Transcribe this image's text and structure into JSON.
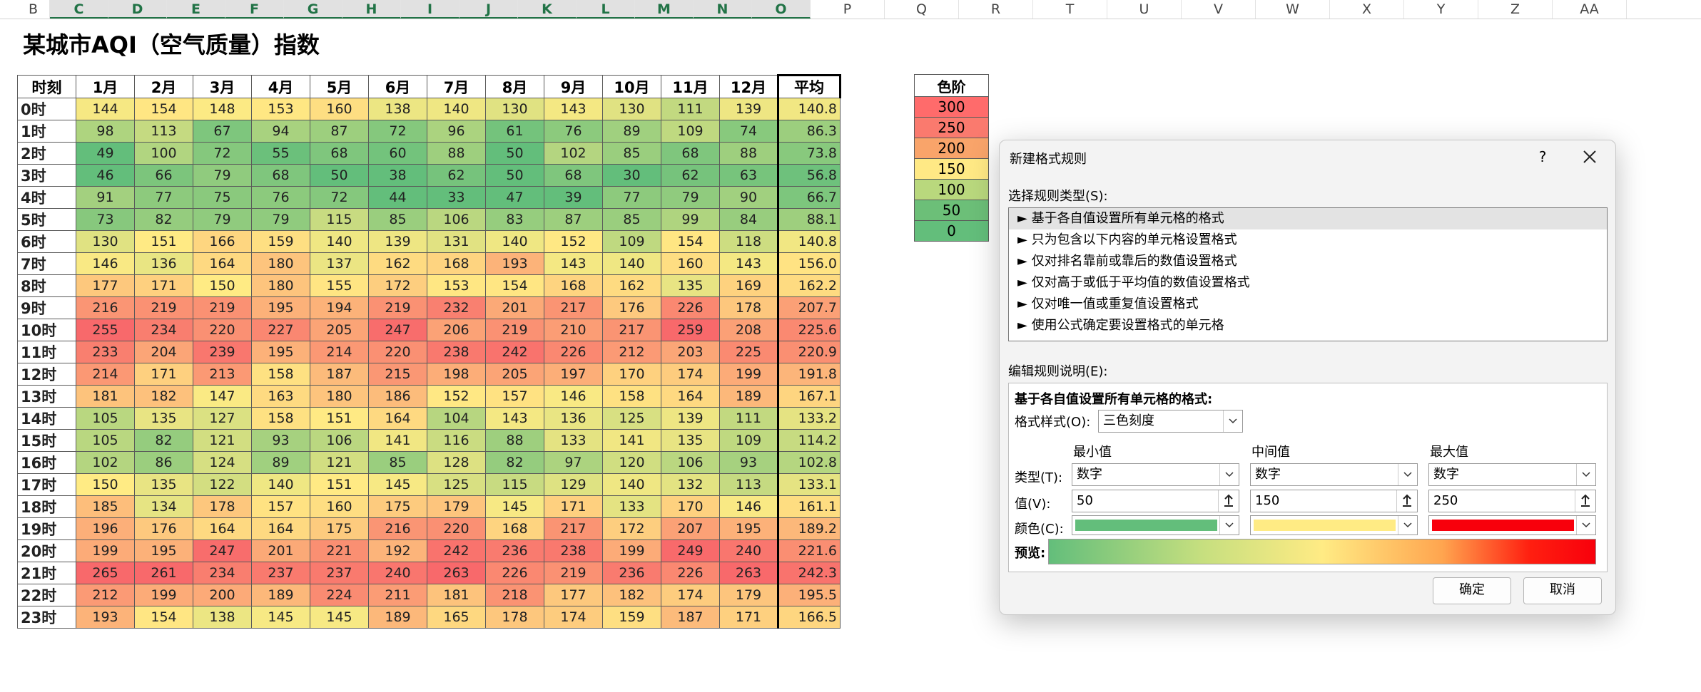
{
  "columns": [
    "B",
    "C",
    "D",
    "E",
    "F",
    "G",
    "H",
    "I",
    "J",
    "K",
    "L",
    "M",
    "N",
    "O",
    "P",
    "Q",
    "R",
    "T",
    "U",
    "V",
    "W",
    "X",
    "Y",
    "Z",
    "AA"
  ],
  "sheet_title": "某城市AQI（空气质量）指数",
  "table": {
    "corner": "时刻",
    "months": [
      "1月",
      "2月",
      "3月",
      "4月",
      "5月",
      "6月",
      "7月",
      "8月",
      "9月",
      "10月",
      "11月",
      "12月"
    ],
    "avg_header": "平均",
    "rows": [
      {
        "hour": "0时",
        "values": [
          144,
          154,
          148,
          153,
          160,
          138,
          140,
          130,
          143,
          130,
          111,
          139
        ],
        "avg": "140.8"
      },
      {
        "hour": "1时",
        "values": [
          98,
          113,
          67,
          94,
          87,
          72,
          96,
          61,
          76,
          89,
          109,
          74
        ],
        "avg": "86.3"
      },
      {
        "hour": "2时",
        "values": [
          49,
          100,
          72,
          55,
          68,
          60,
          88,
          50,
          102,
          85,
          68,
          88
        ],
        "avg": "73.8"
      },
      {
        "hour": "3时",
        "values": [
          46,
          66,
          79,
          68,
          50,
          38,
          62,
          50,
          68,
          30,
          62,
          63
        ],
        "avg": "56.8"
      },
      {
        "hour": "4时",
        "values": [
          91,
          77,
          75,
          76,
          72,
          44,
          33,
          47,
          39,
          77,
          79,
          90
        ],
        "avg": "66.7"
      },
      {
        "hour": "5时",
        "values": [
          73,
          82,
          79,
          79,
          115,
          85,
          106,
          83,
          87,
          85,
          99,
          84
        ],
        "avg": "88.1"
      },
      {
        "hour": "6时",
        "values": [
          130,
          151,
          166,
          159,
          140,
          139,
          131,
          140,
          152,
          109,
          154,
          118
        ],
        "avg": "140.8"
      },
      {
        "hour": "7时",
        "values": [
          146,
          136,
          164,
          180,
          137,
          162,
          168,
          193,
          143,
          140,
          160,
          143
        ],
        "avg": "156.0"
      },
      {
        "hour": "8时",
        "values": [
          177,
          171,
          150,
          180,
          155,
          172,
          153,
          154,
          168,
          162,
          135,
          169
        ],
        "avg": "162.2"
      },
      {
        "hour": "9时",
        "values": [
          216,
          219,
          219,
          195,
          194,
          219,
          232,
          201,
          217,
          176,
          226,
          178
        ],
        "avg": "207.7"
      },
      {
        "hour": "10时",
        "values": [
          255,
          234,
          220,
          227,
          205,
          247,
          206,
          219,
          210,
          217,
          259,
          208
        ],
        "avg": "225.6"
      },
      {
        "hour": "11时",
        "values": [
          233,
          204,
          239,
          195,
          214,
          220,
          238,
          242,
          226,
          212,
          203,
          225
        ],
        "avg": "220.9"
      },
      {
        "hour": "12时",
        "values": [
          214,
          171,
          213,
          158,
          187,
          215,
          198,
          205,
          197,
          170,
          174,
          199
        ],
        "avg": "191.8"
      },
      {
        "hour": "13时",
        "values": [
          181,
          182,
          147,
          163,
          180,
          186,
          152,
          157,
          146,
          158,
          164,
          189
        ],
        "avg": "167.1"
      },
      {
        "hour": "14时",
        "values": [
          105,
          135,
          127,
          158,
          151,
          164,
          104,
          143,
          136,
          125,
          139,
          111
        ],
        "avg": "133.2"
      },
      {
        "hour": "15时",
        "values": [
          105,
          82,
          121,
          93,
          106,
          141,
          116,
          88,
          133,
          141,
          135,
          109
        ],
        "avg": "114.2"
      },
      {
        "hour": "16时",
        "values": [
          102,
          86,
          124,
          89,
          121,
          85,
          128,
          82,
          97,
          120,
          106,
          93
        ],
        "avg": "102.8"
      },
      {
        "hour": "17时",
        "values": [
          150,
          135,
          122,
          140,
          151,
          145,
          125,
          115,
          129,
          140,
          132,
          113
        ],
        "avg": "133.1"
      },
      {
        "hour": "18时",
        "values": [
          185,
          134,
          178,
          157,
          160,
          175,
          179,
          145,
          171,
          133,
          170,
          146
        ],
        "avg": "161.1"
      },
      {
        "hour": "19时",
        "values": [
          196,
          176,
          164,
          164,
          175,
          216,
          220,
          168,
          217,
          172,
          207,
          195
        ],
        "avg": "189.2"
      },
      {
        "hour": "20时",
        "values": [
          199,
          195,
          247,
          201,
          221,
          192,
          242,
          236,
          238,
          199,
          249,
          240
        ],
        "avg": "221.6"
      },
      {
        "hour": "21时",
        "values": [
          265,
          261,
          234,
          237,
          237,
          240,
          263,
          226,
          219,
          236,
          226,
          263
        ],
        "avg": "242.3"
      },
      {
        "hour": "22时",
        "values": [
          212,
          199,
          200,
          189,
          224,
          211,
          181,
          218,
          177,
          182,
          174,
          179
        ],
        "avg": "195.5"
      },
      {
        "hour": "23时",
        "values": [
          193,
          154,
          138,
          145,
          145,
          189,
          165,
          178,
          174,
          159,
          187,
          171
        ],
        "avg": "166.5"
      }
    ]
  },
  "legend": {
    "title": "色阶",
    "items": [
      {
        "label": "300",
        "color": "#ff6b6b"
      },
      {
        "label": "250",
        "color": "#fa7a6e"
      },
      {
        "label": "200",
        "color": "#f9a46a"
      },
      {
        "label": "150",
        "color": "#ffe985"
      },
      {
        "label": "100",
        "color": "#b9d87d"
      },
      {
        "label": "50",
        "color": "#6cbf78"
      },
      {
        "label": "0",
        "color": "#63be7b"
      }
    ]
  },
  "scale": {
    "min": 50,
    "mid": 150,
    "max": 250,
    "min_color": "#63be7b",
    "mid_color": "#ffeb84",
    "max_color": "#f8696b"
  },
  "dialog": {
    "title": "新建格式规则",
    "help": "?",
    "select_type_label": "选择规则类型(S):",
    "rule_types": [
      "► 基于各自值设置所有单元格的格式",
      "► 只为包含以下内容的单元格设置格式",
      "► 仅对排名靠前或靠后的数值设置格式",
      "► 仅对高于或低于平均值的数值设置格式",
      "► 仅对唯一值或重复值设置格式",
      "► 使用公式确定要设置格式的单元格"
    ],
    "edit_desc_label": "编辑规则说明(E):",
    "desc_heading": "基于各自值设置所有单元格的格式:",
    "format_style_label": "格式样式(O):",
    "format_style_value": "三色刻度",
    "min_header": "最小值",
    "mid_header": "中间值",
    "max_header": "最大值",
    "type_label": "类型(T):",
    "value_label": "值(V):",
    "color_label": "颜色(C):",
    "preview_label": "预览:",
    "min_type": "数字",
    "mid_type": "数字",
    "max_type": "数字",
    "min_value": "50",
    "mid_value": "150",
    "max_value": "250",
    "min_color": "#63be7b",
    "mid_color": "#ffeb84",
    "max_color": "#f8000c",
    "ok": "确定",
    "cancel": "取消"
  }
}
